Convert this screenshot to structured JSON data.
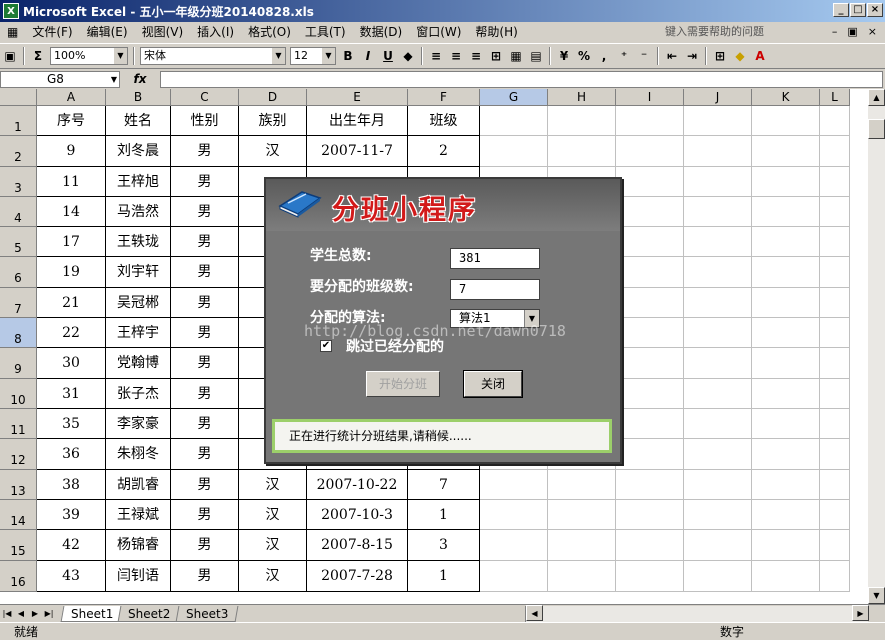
{
  "window": {
    "title": "Microsoft Excel - 五小一年级分班20140828.xls"
  },
  "menu": {
    "items": [
      "文件(F)",
      "编辑(E)",
      "视图(V)",
      "插入(I)",
      "格式(O)",
      "工具(T)",
      "数据(D)",
      "窗口(W)",
      "帮助(H)"
    ],
    "help_placeholder": "键入需要帮助的问题"
  },
  "toolbar": {
    "zoom": "100%",
    "font": "宋体",
    "size": "12",
    "bold": "B",
    "italic": "I",
    "underline": "U",
    "percent": "%",
    "sigma": "Σ"
  },
  "formula": {
    "name_box": "G8",
    "fx": "fx"
  },
  "sheet": {
    "columns": [
      "A",
      "B",
      "C",
      "D",
      "E",
      "F",
      "G",
      "H",
      "I",
      "J",
      "K",
      "L"
    ],
    "rows": [
      "1",
      "2",
      "3",
      "4",
      "5",
      "6",
      "7",
      "8",
      "9",
      "10",
      "11",
      "12",
      "13",
      "14",
      "15",
      "16"
    ],
    "table_header": [
      "序号",
      "姓名",
      "性别",
      "族别",
      "出生年月",
      "班级"
    ],
    "table_rows": [
      [
        "9",
        "刘冬晨",
        "男",
        "汉",
        "2007-11-7",
        "2"
      ],
      [
        "11",
        "王梓旭",
        "男",
        "",
        "",
        ""
      ],
      [
        "14",
        "马浩然",
        "男",
        "",
        "",
        ""
      ],
      [
        "17",
        "王轶珑",
        "男",
        "",
        "",
        ""
      ],
      [
        "19",
        "刘宇轩",
        "男",
        "",
        "",
        ""
      ],
      [
        "21",
        "吴冠郴",
        "男",
        "",
        "",
        ""
      ],
      [
        "22",
        "王梓宇",
        "男",
        "",
        "",
        ""
      ],
      [
        "30",
        "党翰博",
        "男",
        "",
        "",
        ""
      ],
      [
        "31",
        "张子杰",
        "男",
        "",
        "",
        ""
      ],
      [
        "35",
        "李家豪",
        "男",
        "",
        "",
        ""
      ],
      [
        "36",
        "朱栩冬",
        "男",
        "",
        "",
        ""
      ],
      [
        "38",
        "胡凯睿",
        "男",
        "汉",
        "2007-10-22",
        "7"
      ],
      [
        "39",
        "王禄斌",
        "男",
        "汉",
        "2007-10-3",
        "1"
      ],
      [
        "42",
        "杨锦睿",
        "男",
        "汉",
        "2007-8-15",
        "3"
      ],
      [
        "43",
        "闫钊语",
        "男",
        "汉",
        "2007-7-28",
        "1"
      ]
    ]
  },
  "tabs": [
    "Sheet1",
    "Sheet2",
    "Sheet3"
  ],
  "status": {
    "left": "就绪",
    "num": "数字"
  },
  "dialog": {
    "title": "分班小程序",
    "total_label": "学生总数:",
    "total_value": "381",
    "classes_label": "要分配的班级数:",
    "classes_value": "7",
    "algo_label": "分配的算法:",
    "algo_value": "算法1",
    "skip_label": "跳过已经分配的",
    "start_button": "开始分班",
    "close_button": "关闭",
    "status_text": "正在进行统计分班结果,请稍候......"
  },
  "watermark": "http://blog.csdn.net/dawn0718",
  "colors": {
    "accent_title": "#d21a1a",
    "status_border": "#9ccf6a",
    "selected_header": "#b6c9e6"
  }
}
